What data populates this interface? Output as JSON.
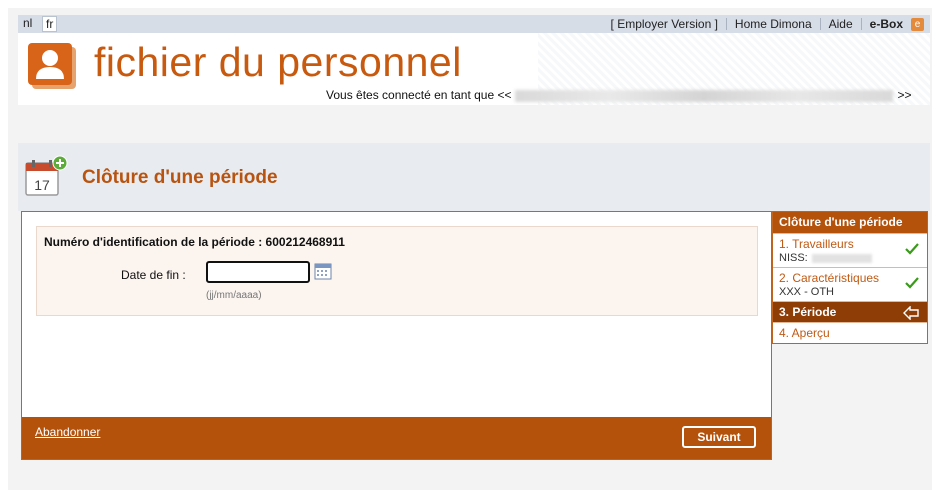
{
  "topbar": {
    "languages": [
      "nl",
      "fr"
    ],
    "active_language": "fr",
    "links": [
      "[ Employer Version ]",
      "Home Dimona",
      "Aide",
      "e-Box"
    ],
    "ebox_icon_glyph": "e"
  },
  "header": {
    "app_title": "fichier du personnel",
    "connected_prefix": "Vous êtes connecté en tant que <<",
    "connected_suffix": ">>"
  },
  "page": {
    "title": "Clôture d'une période",
    "calendar_day": "17"
  },
  "form": {
    "period_id_text": "Numéro d'identification de la période : 600212468911",
    "end_date_label": "Date de fin :",
    "end_date_value": "",
    "date_format_hint": "(jj/mm/aaaa)",
    "cancel_label": "Abandonner",
    "next_label": "Suivant"
  },
  "steps": {
    "title": "Clôture d'une période",
    "items": [
      {
        "label": "1. Travailleurs",
        "sub": "NISS:",
        "status": "done"
      },
      {
        "label": "2. Caractéristiques",
        "sub": "XXX -  OTH",
        "status": "done"
      },
      {
        "label": "3. Période",
        "sub": "",
        "status": "current"
      },
      {
        "label": "4. Aperçu",
        "sub": "",
        "status": "pending"
      }
    ]
  },
  "colors": {
    "brand_orange": "#c85a10",
    "footer_brown": "#b4520c",
    "current_step": "#8e3d06",
    "check_green": "#3a9a1a"
  },
  "icons": [
    "person-logo-icon",
    "calendar-add-icon",
    "calendar-picker-icon",
    "checkmark-icon",
    "arrow-left-icon",
    "ebox-icon"
  ]
}
